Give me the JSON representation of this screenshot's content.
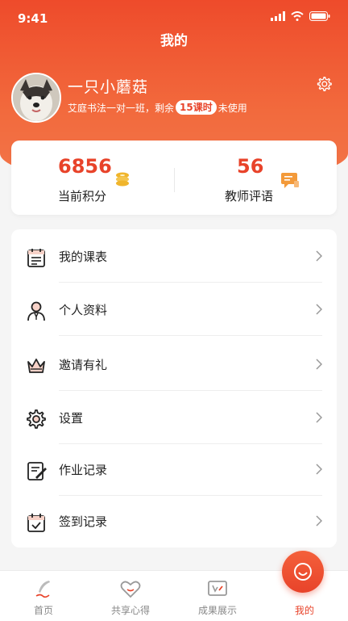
{
  "status": {
    "time": "9:41"
  },
  "page": {
    "title": "我的"
  },
  "user": {
    "name": "一只小蘑菇",
    "course_prefix": "艾庭书法一对一班，剩余",
    "remaining": "15课时",
    "course_suffix": "未使用"
  },
  "stats": [
    {
      "value": "6856",
      "label": "当前积分",
      "icon": "coins-icon"
    },
    {
      "value": "56",
      "label": "教师评语",
      "icon": "comment-icon"
    }
  ],
  "menu": {
    "items": [
      {
        "label": "我的课表",
        "icon": "schedule-icon"
      },
      {
        "label": "个人资料",
        "icon": "profile-icon"
      },
      {
        "label": "邀请有礼",
        "icon": "crown-icon"
      },
      {
        "label": "设置",
        "icon": "gear-icon"
      },
      {
        "label": "作业记录",
        "icon": "homework-icon"
      },
      {
        "label": "签到记录",
        "icon": "calendar-check-icon"
      }
    ]
  },
  "tabs": [
    {
      "label": "首页",
      "icon": "brush-icon"
    },
    {
      "label": "共享心得",
      "icon": "heart-icon"
    },
    {
      "label": "成果展示",
      "icon": "display-icon"
    },
    {
      "label": "我的",
      "icon": "smile-icon",
      "active": true
    }
  ],
  "colors": {
    "accent": "#e8432a",
    "header": "#ee4b2b",
    "coin": "#f0b52c",
    "comment": "#f39a3a"
  }
}
